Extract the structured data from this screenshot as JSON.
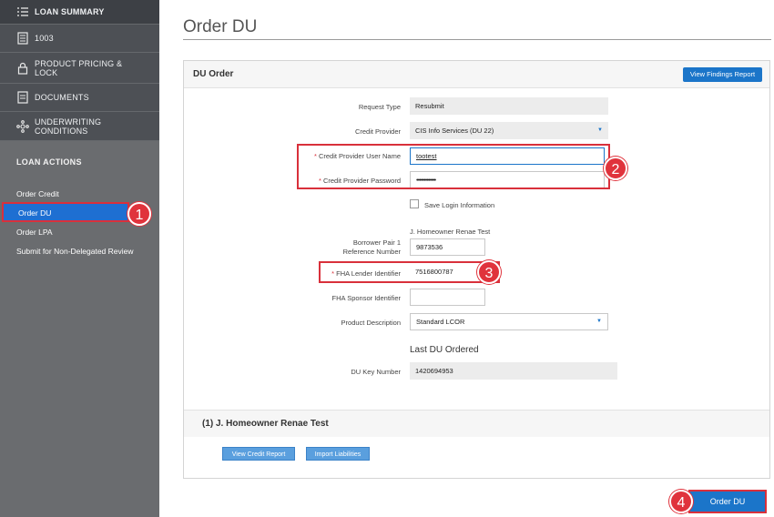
{
  "sidebar": {
    "nav": [
      {
        "label": "LOAN SUMMARY",
        "icon": "list-icon"
      },
      {
        "label": "1003",
        "icon": "form-icon"
      },
      {
        "label": "PRODUCT PRICING & LOCK",
        "icon": "lock-icon"
      },
      {
        "label": "DOCUMENTS",
        "icon": "document-icon"
      },
      {
        "label": "UNDERWRITING CONDITIONS",
        "icon": "network-icon"
      }
    ],
    "actions_title": "LOAN ACTIONS",
    "actions": [
      "Order Credit",
      "Order DU",
      "Order LPA",
      "Submit for Non-Delegated Review"
    ]
  },
  "callouts": [
    "1",
    "2",
    "3",
    "4"
  ],
  "main": {
    "title": "Order DU",
    "panel": {
      "title": "DU Order",
      "findings_button": "View Findings Report",
      "fields": {
        "request_type": {
          "label": "Request Type",
          "value": "Resubmit"
        },
        "credit_provider": {
          "label": "Credit Provider",
          "value": "CIS Info Services (DU 22)"
        },
        "cp_user": {
          "required": "*",
          "label": "Credit Provider User Name",
          "value": "tootest"
        },
        "cp_password": {
          "required": "*",
          "label": "Credit Provider Password",
          "value": "•••••••••••••"
        },
        "save_login": {
          "label": "Save Login Information",
          "checked": false
        },
        "borrower_name": "J. Homeowner Renae Test",
        "borrower_ref": {
          "label_line1": "Borrower Pair 1",
          "label_line2": "Reference Number",
          "value": "9873536"
        },
        "fha_lender": {
          "required": "*",
          "label": "FHA Lender Identifier",
          "value": "7516800787"
        },
        "fha_sponsor": {
          "label": "FHA Sponsor Identifier",
          "value": ""
        },
        "product_description": {
          "label": "Product Description",
          "value": "Standard LCOR"
        },
        "last_du_heading": "Last DU Ordered",
        "du_key": {
          "label": "DU Key Number",
          "value": "1420694953"
        }
      },
      "borrower_section": {
        "title": "(1) J. Homeowner Renae Test",
        "view_credit": "View Credit Report",
        "import_liabilities": "Import Liabilities"
      }
    },
    "order_button": "Order DU"
  },
  "colors": {
    "accent": "#1b75c9",
    "highlight": "#d9303b",
    "sidebar": "#6a6c6f"
  }
}
